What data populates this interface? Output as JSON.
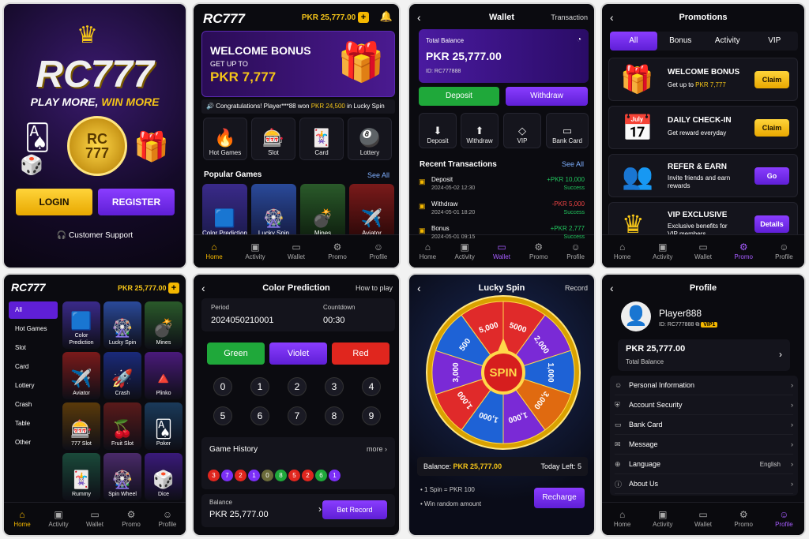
{
  "login": {
    "brand": "RC777",
    "tagline1": "PLAY MORE, ",
    "tagline2": "WIN MORE",
    "coin_text": "RC\n777",
    "login": "LOGIN",
    "register": "REGISTER",
    "support": "Customer Support"
  },
  "home": {
    "logo": "RC777",
    "balance": "PKR 25,777.00",
    "bonus_title": "WELCOME BONUS",
    "bonus_sub": "GET UP TO",
    "bonus_amount": "PKR 7,777",
    "ticker_pre": "Congratulations! Player***88 won ",
    "ticker_amt": "PKR 24,500",
    "ticker_post": " in Lucky Spin",
    "cats": [
      {
        "label": "Hot Games",
        "icon": "fire"
      },
      {
        "label": "Slot",
        "icon": "slot"
      },
      {
        "label": "Card",
        "icon": "cards"
      },
      {
        "label": "Lottery",
        "icon": "balls"
      }
    ],
    "popular": "Popular Games",
    "see_all": "See All",
    "games": [
      {
        "label": "Color Prediction"
      },
      {
        "label": "Lucky Spin"
      },
      {
        "label": "Mines"
      },
      {
        "label": "Aviator"
      }
    ]
  },
  "nav": {
    "home": "Home",
    "activity": "Activity",
    "wallet": "Wallet",
    "promo": "Promo",
    "profile": "Profile"
  },
  "wallet": {
    "title": "Wallet",
    "right": "Transaction",
    "total_label": "Total Balance",
    "total": "PKR 25,777.00",
    "id": "ID: RC777888",
    "deposit": "Deposit",
    "withdraw": "Withdraw",
    "quick": [
      "Deposit",
      "Withdraw",
      "VIP",
      "Bank Card"
    ],
    "recent": "Recent Transactions",
    "see_all": "See All",
    "tx": [
      {
        "name": "Deposit",
        "date": "2024-05-02 12:30",
        "amount": "+PKR 10,000",
        "status": "Success",
        "color": "#22c55e"
      },
      {
        "name": "Withdraw",
        "date": "2024-05-01 18:20",
        "amount": "-PKR 5,000",
        "status": "Success",
        "color": "#ef4444"
      },
      {
        "name": "Bonus",
        "date": "2024-05-01 09:15",
        "amount": "+PKR 2,777",
        "status": "Success",
        "color": "#22c55e"
      }
    ]
  },
  "promo": {
    "title": "Promotions",
    "tabs": [
      "All",
      "Bonus",
      "Activity",
      "VIP"
    ],
    "items": [
      {
        "title": "WELCOME BONUS",
        "sub": "Get up to ",
        "sub_hl": "PKR 7,777",
        "btn": "Claim",
        "icon": "gift"
      },
      {
        "title": "DAILY CHECK-IN",
        "sub": "Get reward everyday",
        "sub_hl": "",
        "btn": "Claim",
        "icon": "calendar"
      },
      {
        "title": "REFER & EARN",
        "sub": "Invite friends and earn rewards",
        "sub_hl": "",
        "btn": "Go",
        "icon": "friends"
      },
      {
        "title": "VIP EXCLUSIVE",
        "sub": "Exclusive benefits for VIP members",
        "sub_hl": "",
        "btn": "Details",
        "icon": "crown"
      }
    ]
  },
  "lobby": {
    "logo": "RC777",
    "balance": "PKR 25,777.00",
    "side": [
      "All",
      "Hot Games",
      "Slot",
      "Card",
      "Lottery",
      "Crash",
      "Table",
      "Other"
    ],
    "games": [
      "Color Prediction",
      "Lucky Spin",
      "Mines",
      "Aviator",
      "Crash",
      "Plinko",
      "777 Slot",
      "Fruit Slot",
      "Poker",
      "Rummy",
      "Spin Wheel",
      "Dice"
    ]
  },
  "color": {
    "title": "Color Prediction",
    "right": "How to play",
    "period_label": "Period",
    "period": "2024050210001",
    "count_label": "Countdown",
    "count": "00:30",
    "green": "Green",
    "violet": "Violet",
    "red": "Red",
    "nums": [
      "0",
      "1",
      "2",
      "3",
      "4",
      "5",
      "6",
      "7",
      "8",
      "9"
    ],
    "history": "Game History",
    "more": "more",
    "hist": [
      "3",
      "7",
      "2",
      "1",
      "0",
      "8",
      "5",
      "2",
      "6",
      "1"
    ],
    "bal_label": "Balance",
    "balance": "PKR 25,777.00",
    "bet_record": "Bet Record"
  },
  "spin": {
    "title": "Lucky Spin",
    "right": "Record",
    "center": "SPIN",
    "values": [
      "5000",
      "2,000",
      "1,000",
      "3,000",
      "1,000",
      "1,000",
      "1,000",
      "3,000",
      "500",
      "5,000"
    ],
    "bal_label": "Balance: ",
    "balance": "PKR 25,777.00",
    "left_label": "Today Left: ",
    "left": "5",
    "rule1": "• 1 Spin = PKR 100",
    "rule2": "• Win random amount",
    "recharge": "Recharge"
  },
  "profile": {
    "title": "Profile",
    "name": "Player888",
    "id": "ID: RC777888",
    "vip": "VIP1",
    "balance": "PKR 25,777.00",
    "bal_label": "Total Balance",
    "menu": [
      {
        "label": "Personal Information",
        "right": ""
      },
      {
        "label": "Account Security",
        "right": ""
      },
      {
        "label": "Bank Card",
        "right": ""
      },
      {
        "label": "Message",
        "right": ""
      },
      {
        "label": "Language",
        "right": "English"
      },
      {
        "label": "About Us",
        "right": ""
      }
    ]
  },
  "colors": {
    "gold": "#f5b800",
    "purple": "#7b2ff7",
    "green": "#1fa83a",
    "red": "#e0261e"
  }
}
